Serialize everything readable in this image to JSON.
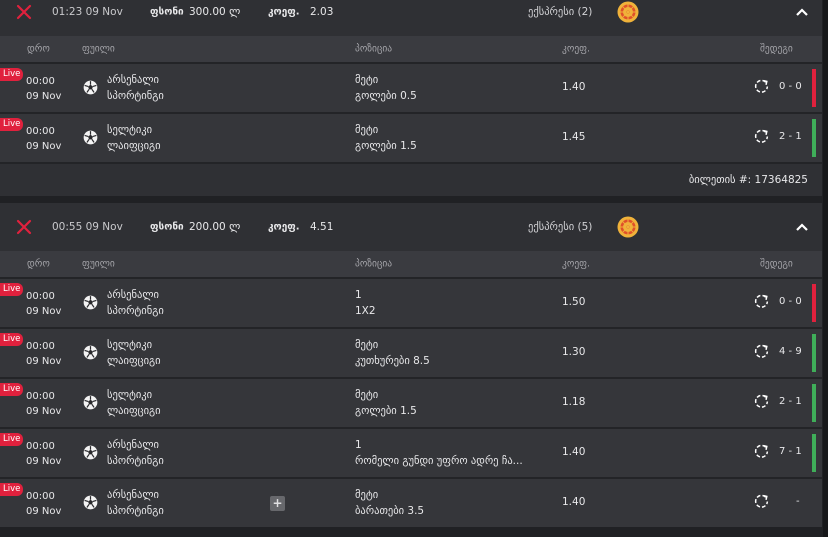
{
  "colors": {
    "win": "#3fae59",
    "loss": "#e0213d",
    "live": "#e0213d"
  },
  "columns": {
    "date": "დრო",
    "event": "ფუილი",
    "position": "პოზიცია",
    "odds": "კოეფ.",
    "score": "შედეგი"
  },
  "live_label": "Live",
  "tickets": [
    {
      "date": "01:23 09 Nov",
      "stake_label": "ფსონი",
      "stake": "300.00 ლ",
      "odds_label": "კოეფ.",
      "odds": "2.03",
      "express": "ექსპრესი (2)",
      "footer": "ბილეთის #: 17364825",
      "rows": [
        {
          "time": "00:00",
          "date": "09 Nov",
          "team1": "არსენალი",
          "team2": "სპორტინგი",
          "pos1": "მეტი",
          "pos2": "გოლები 0.5",
          "odds": "1.40",
          "score": "0 - 0",
          "status": "loss"
        },
        {
          "time": "00:00",
          "date": "09 Nov",
          "team1": "სელტიკი",
          "team2": "ლაიფციგი",
          "pos1": "მეტი",
          "pos2": "გოლები 1.5",
          "odds": "1.45",
          "score": "2 - 1",
          "status": "win"
        }
      ]
    },
    {
      "date": "00:55 09 Nov",
      "stake_label": "ფსონი",
      "stake": "200.00 ლ",
      "odds_label": "კოეფ.",
      "odds": "4.51",
      "express": "ექსპრესი (5)",
      "rows": [
        {
          "time": "00:00",
          "date": "09 Nov",
          "team1": "არსენალი",
          "team2": "სპორტინგი",
          "pos1": "1",
          "pos2": "1X2",
          "odds": "1.50",
          "score": "0 - 0",
          "status": "loss"
        },
        {
          "time": "00:00",
          "date": "09 Nov",
          "team1": "სელტიკი",
          "team2": "ლაიფციგი",
          "pos1": "მეტი",
          "pos2": "კუთხურები 8.5",
          "odds": "1.30",
          "score": "4 - 9",
          "status": "win"
        },
        {
          "time": "00:00",
          "date": "09 Nov",
          "team1": "სელტიკი",
          "team2": "ლაიფციგი",
          "pos1": "მეტი",
          "pos2": "გოლები 1.5",
          "odds": "1.18",
          "score": "2 - 1",
          "status": "win"
        },
        {
          "time": "00:00",
          "date": "09 Nov",
          "team1": "არსენალი",
          "team2": "სპორტინგი",
          "pos1": "1",
          "pos2": "რომელი გუნდი უფრო ადრე ჩა...",
          "odds": "1.40",
          "score": "7 - 1",
          "status": "win"
        },
        {
          "time": "00:00",
          "date": "09 Nov",
          "team1": "არსენალი",
          "team2": "სპორტინგი",
          "pos1": "მეტი",
          "pos2": "ბარათები 3.5",
          "odds": "1.40",
          "score": "-",
          "status": "pending",
          "add_button": "+"
        }
      ]
    }
  ]
}
